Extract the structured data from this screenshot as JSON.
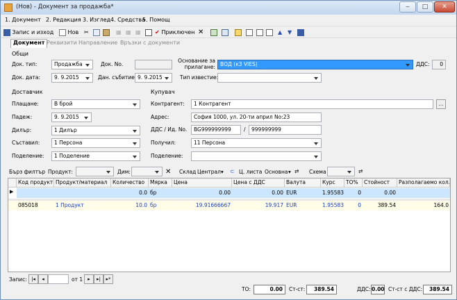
{
  "window": {
    "title": "(Нов) - Документ за продажба*",
    "controls": [
      "minimize",
      "maximize",
      "close"
    ]
  },
  "menu": [
    "1. Документ",
    "2. Редакция",
    "3. Изглед",
    "4. Средства",
    "5. Помощ"
  ],
  "toolbar": {
    "save_exit": "Запис и изход",
    "new": "Нов",
    "apply": "Приключен"
  },
  "tabs": [
    "Документ",
    "Реквизити",
    "Направление",
    "Връзки с документи"
  ],
  "general": {
    "section": "Общи",
    "doc_type_label": "Док. тип:",
    "doc_type_value": "Продажба",
    "doc_no_label": "Док. No.",
    "doc_no_value": "",
    "basis_label": "Основание за прилагане:",
    "basis_value": "ВОД (кЗ VIES)",
    "vat_label": "ДДС:",
    "vat_value": "0",
    "doc_date_label": "Док. дата:",
    "doc_date_value": "9.  9.2015",
    "event_date_label": "Дан. събитие:",
    "event_date_value": "9.  9.2015",
    "notice_label": "Тип известие:",
    "notice_value": ""
  },
  "supplier": {
    "section": "Доставчик",
    "payment_label": "Плащане:",
    "payment_value": "В брой",
    "due_label": "Падеж:",
    "due_value": "9.  9.2015",
    "dealer_label": "Дилър:",
    "dealer_value": "1 Дилър",
    "composed_label": "Съставил:",
    "composed_value": "1 Персона",
    "division_label": "Поделение:",
    "division_value": "1 Поделение"
  },
  "buyer": {
    "section": "Купувач",
    "contragent_label": "Контрагент:",
    "contragent_value": "1 Контрагент",
    "address_label": "Адрес:",
    "address_value": "София 1000, ул. 20-ти април No:23",
    "vat_label": "ДДС / Ид. No.",
    "vat_value": "BG999999999",
    "id_value": "999999999",
    "received_label": "Получил:",
    "received_value": "11 Персона",
    "division_label": "Поделение:",
    "division_value": ""
  },
  "filterbar": {
    "quick_filter": "Бърз филтър",
    "product": "Продукт:",
    "dim": "Дим:",
    "warehouse": "Склад",
    "warehouse_value": "Централ",
    "price_list": "Ц. листа",
    "price_list_value": "Основна",
    "schema": "Схема"
  },
  "grid": {
    "columns": [
      "Код продукт...",
      "Продукт/материал",
      "Количество",
      "Мярка",
      "Цена",
      "Цена с ДДС",
      "Валута",
      "Курс",
      "ТО%",
      "Стойност",
      "Разполагаемо кол."
    ],
    "rows": [
      [
        "",
        "",
        "0.0",
        "бр",
        "0.00",
        "0.00",
        "EUR",
        "1.95583",
        "0",
        "0.00",
        ""
      ],
      [
        "085018",
        "1 Продукт",
        "10.0",
        "бр",
        "19.91666667",
        "19.917",
        "EUR",
        "1.95583",
        "0",
        "389.54",
        "164.0"
      ]
    ]
  },
  "nav": {
    "record_label": "Запис:",
    "current": "",
    "of": "от 1"
  },
  "totals": {
    "to_label": "ТО:",
    "to_value": "0.00",
    "st_label": "Ст-ст:",
    "st_value": "389.54",
    "vat_label": "ДДС:",
    "vat_value": "0.00",
    "st_vat_label": "Ст-ст с ДДС:",
    "st_vat_value": "389.54"
  },
  "colors": {
    "highlight": "#3399ff",
    "link_blue": "#1a40c8",
    "row_selected": "#cde6ff"
  }
}
